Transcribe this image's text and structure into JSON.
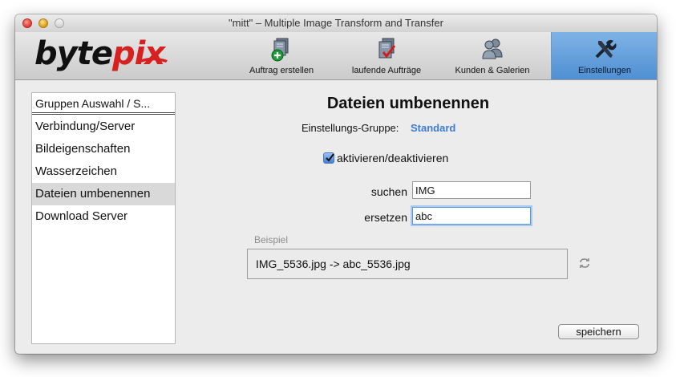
{
  "window": {
    "title": "\"mitt\" – Multiple Image Transform and Transfer"
  },
  "logo": {
    "part1": "byte",
    "part2": "pix"
  },
  "toolbar": {
    "items": [
      {
        "label": "Auftrag erstellen",
        "icon": "add-document-icon"
      },
      {
        "label": "laufende Aufträge",
        "icon": "document-check-icon"
      },
      {
        "label": "Kunden & Galerien",
        "icon": "users-icon"
      },
      {
        "label": "Einstellungen",
        "icon": "tools-icon",
        "active": true
      }
    ]
  },
  "sidebar": {
    "group_select": "Gruppen Auswahl / S...",
    "items": [
      {
        "label": "Verbindung/Server"
      },
      {
        "label": "Bildeigenschaften"
      },
      {
        "label": "Wasserzeichen"
      },
      {
        "label": "Dateien umbenennen",
        "selected": true
      },
      {
        "label": "Download Server"
      }
    ]
  },
  "main": {
    "title": "Dateien umbenennen",
    "group_label": "Einstellungs-Gruppe:",
    "group_value": "Standard",
    "checkbox_label": "aktivieren/deaktivieren",
    "checkbox_checked": true,
    "search_label": "suchen",
    "search_value": "IMG",
    "replace_label": "ersetzen",
    "replace_value": "abc",
    "example_label": "Beispiel",
    "example_text": "IMG_5536.jpg -> abc_5536.jpg",
    "save_label": "speichern"
  },
  "colors": {
    "accent": "#3d7bd9",
    "active_tab": "#5f9be0",
    "logo_red": "#d72020"
  }
}
